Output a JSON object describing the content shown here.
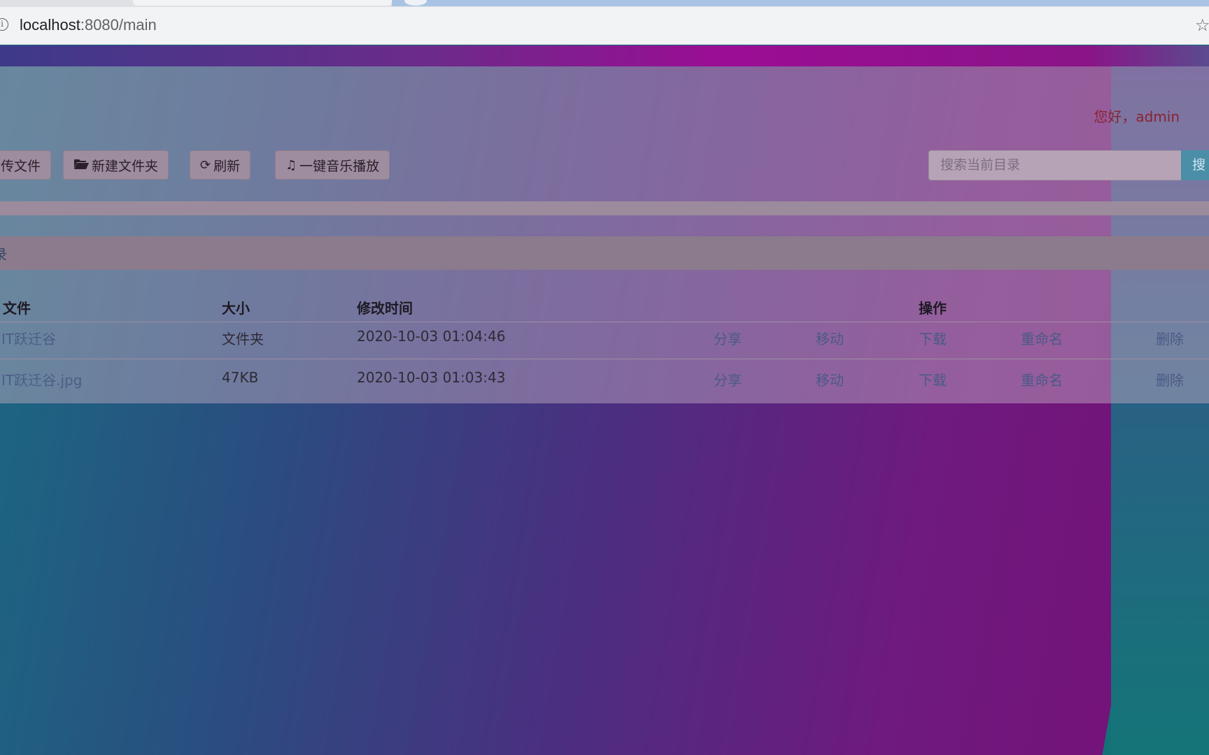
{
  "browser": {
    "url_host": "localhost",
    "url_rest": ":8080/main"
  },
  "header": {
    "greeting": "您好，admin"
  },
  "toolbar": {
    "upload_label": "传文件",
    "mkdir_label": "新建文件夹",
    "refresh_label": "刷新",
    "music_label": "一键音乐播放",
    "search_placeholder": "搜索当前目录",
    "search_label": "搜"
  },
  "breadcrumb": {
    "current": "录"
  },
  "table": {
    "headers": {
      "file": "文件",
      "size": "大小",
      "modified": "修改时间",
      "actions": "操作"
    },
    "rows": [
      {
        "name": "IT跃迁谷",
        "size": "文件夹",
        "modified": "2020-10-03 01:04:46",
        "share": "分享",
        "move": "移动",
        "download": "下载",
        "rename": "重命名",
        "delete": "删除"
      },
      {
        "name": "IT跃迁谷.jpg",
        "size": "47KB",
        "modified": "2020-10-03 01:03:43",
        "share": "分享",
        "move": "移动",
        "download": "下载",
        "rename": "重命名",
        "delete": "删除"
      }
    ]
  },
  "icons": {
    "info": "info-icon",
    "star": "star-icon",
    "folder_open": "folder-open-icon",
    "refresh": "refresh-icon",
    "music": "music-note-icon"
  }
}
